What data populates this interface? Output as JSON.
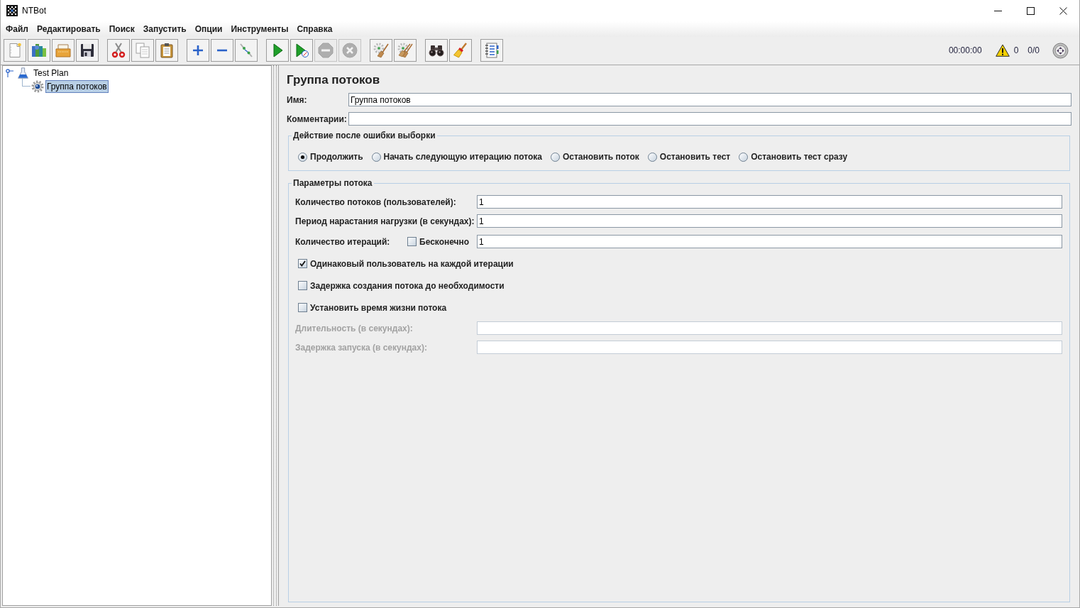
{
  "window": {
    "title": "NTBot"
  },
  "menu": [
    "Файл",
    "Редактировать",
    "Поиск",
    "Запустить",
    "Опции",
    "Инструменты",
    "Справка"
  ],
  "toolbar": {
    "groups": [
      {
        "buttons": [
          {
            "kind": "new",
            "disabled": false
          },
          {
            "kind": "templates",
            "disabled": false
          },
          {
            "kind": "open",
            "disabled": false
          },
          {
            "kind": "save",
            "disabled": false
          }
        ]
      },
      {
        "buttons": [
          {
            "kind": "cut",
            "disabled": false
          },
          {
            "kind": "copy",
            "disabled": false
          },
          {
            "kind": "paste",
            "disabled": false
          }
        ]
      },
      {
        "buttons": [
          {
            "kind": "expand",
            "disabled": false
          },
          {
            "kind": "collapse",
            "disabled": false
          },
          {
            "kind": "toggle",
            "disabled": false
          }
        ]
      },
      {
        "buttons": [
          {
            "kind": "start",
            "disabled": false
          },
          {
            "kind": "start-no-pauses",
            "disabled": false
          },
          {
            "kind": "stop",
            "disabled": true
          },
          {
            "kind": "shutdown",
            "disabled": true
          }
        ]
      },
      {
        "buttons": [
          {
            "kind": "clear",
            "disabled": false
          },
          {
            "kind": "clear-all",
            "disabled": false
          }
        ]
      },
      {
        "buttons": [
          {
            "kind": "search",
            "disabled": false
          },
          {
            "kind": "reset-search",
            "disabled": false
          }
        ]
      },
      {
        "buttons": [
          {
            "kind": "function-helper",
            "disabled": false
          }
        ]
      }
    ]
  },
  "status": {
    "elapsed": "00:00:00",
    "warnings": "0",
    "threads": "0/0"
  },
  "tree": [
    {
      "kind": "test-plan",
      "label": "Test Plan",
      "expanded": true,
      "selected": false,
      "children": [
        {
          "kind": "thread-group",
          "label": "Группа потоков",
          "selected": true
        }
      ]
    }
  ],
  "editor": {
    "title": "Группа потоков",
    "name": {
      "label": "Имя:",
      "value": "Группа потоков"
    },
    "comments": {
      "label": "Комментарии:"
    },
    "sampler_error_action": {
      "title": "Действие после ошибки выборки",
      "options": [
        {
          "label": "Продолжить",
          "selected": true
        },
        {
          "label": "Начать следующую итерацию потока",
          "selected": false
        },
        {
          "label": "Остановить поток",
          "selected": false
        },
        {
          "label": "Остановить тест",
          "selected": false
        },
        {
          "label": "Остановить тест сразу",
          "selected": false
        }
      ]
    },
    "thread_properties": {
      "title": "Параметры потока",
      "fields": [
        {
          "kind": "text",
          "label": "Количество потоков (пользователей):",
          "value": "1",
          "disabled": false
        },
        {
          "kind": "text",
          "label": "Период нарастания нагрузки (в секундах):",
          "value": "1",
          "disabled": false
        },
        {
          "kind": "loop",
          "label": "Количество итераций:",
          "infinite": {
            "label": "Бесконечно",
            "checked": false
          },
          "value": "1",
          "disabled": false
        },
        {
          "kind": "checkbox",
          "label": "Одинаковый пользователь на каждой итерации",
          "checked": true
        },
        {
          "kind": "checkbox",
          "label": "Задержка создания потока до необходимости",
          "checked": false
        },
        {
          "kind": "checkbox",
          "label": "Установить время жизни потока",
          "checked": false
        },
        {
          "kind": "text",
          "label": "Длительность (в секундах):",
          "disabled": true
        },
        {
          "kind": "text",
          "label": "Задержка запуска (в секундах):",
          "disabled": true
        }
      ]
    }
  }
}
